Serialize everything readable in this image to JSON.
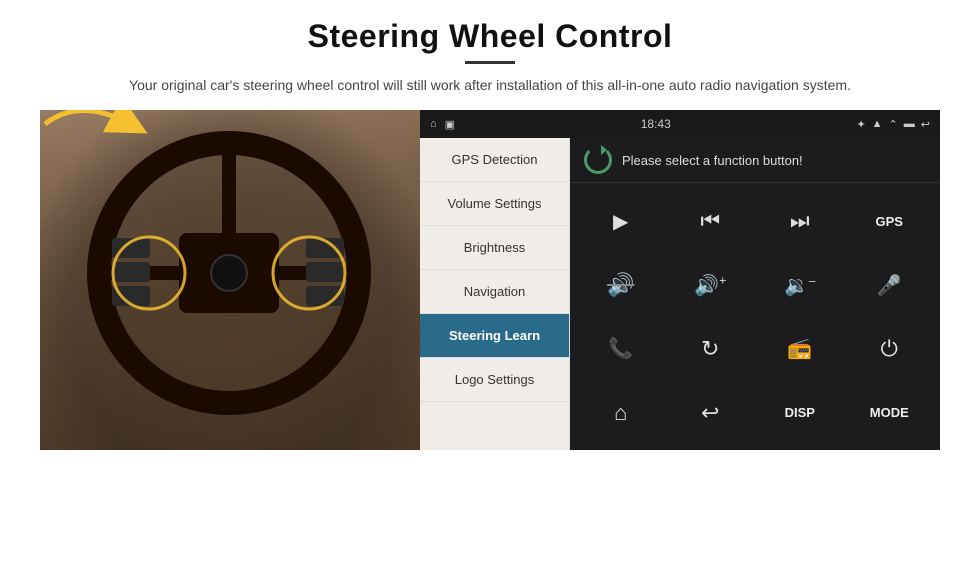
{
  "header": {
    "title": "Steering Wheel Control",
    "description": "Your original car's steering wheel control will still work after installation of this all-in-one auto radio navigation system."
  },
  "status_bar": {
    "home_icon": "⌂",
    "photo_icon": "▣",
    "bluetooth_icon": "✦",
    "wifi_icon": "▲",
    "time": "18:43",
    "arrow_icon": "⌃",
    "battery_icon": "▬",
    "back_icon": "↩"
  },
  "menu": {
    "items": [
      {
        "label": "GPS Detection",
        "active": false
      },
      {
        "label": "Volume Settings",
        "active": false
      },
      {
        "label": "Brightness",
        "active": false
      },
      {
        "label": "Navigation",
        "active": false
      },
      {
        "label": "Steering Learn",
        "active": true
      },
      {
        "label": "Logo Settings",
        "active": false
      }
    ]
  },
  "function_panel": {
    "header_text": "Please select a function button!",
    "buttons": [
      {
        "id": "play",
        "icon": "▶",
        "label": ""
      },
      {
        "id": "prev",
        "icon": "⏮",
        "label": ""
      },
      {
        "id": "next",
        "icon": "⏭",
        "label": ""
      },
      {
        "id": "gps",
        "icon": "",
        "label": "GPS"
      },
      {
        "id": "mute",
        "icon": "⊘",
        "label": ""
      },
      {
        "id": "vol-up",
        "icon": "🔊+",
        "label": ""
      },
      {
        "id": "vol-down",
        "icon": "🔉-",
        "label": ""
      },
      {
        "id": "mic",
        "icon": "🎤",
        "label": ""
      },
      {
        "id": "phone",
        "icon": "📞",
        "label": ""
      },
      {
        "id": "source",
        "icon": "↻",
        "label": ""
      },
      {
        "id": "radio",
        "icon": "📻",
        "label": ""
      },
      {
        "id": "power",
        "icon": "⏻",
        "label": ""
      },
      {
        "id": "home",
        "icon": "⌂",
        "label": ""
      },
      {
        "id": "back",
        "icon": "↩",
        "label": ""
      },
      {
        "id": "disp",
        "icon": "",
        "label": "DISP"
      },
      {
        "id": "mode",
        "icon": "",
        "label": "MODE"
      }
    ]
  }
}
